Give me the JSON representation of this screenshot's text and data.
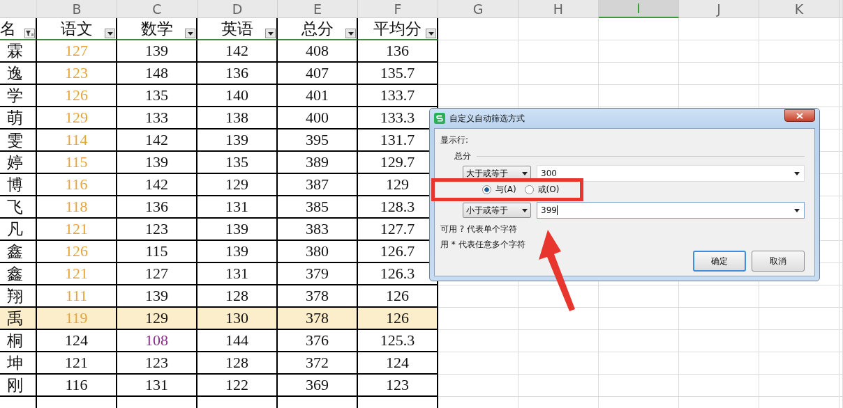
{
  "column_headers": [
    {
      "label": "B",
      "selected": false
    },
    {
      "label": "C",
      "selected": false
    },
    {
      "label": "D",
      "selected": false
    },
    {
      "label": "E",
      "selected": false
    },
    {
      "label": "F",
      "selected": false
    },
    {
      "label": "G",
      "selected": false
    },
    {
      "label": "H",
      "selected": false
    },
    {
      "label": "I",
      "selected": true
    },
    {
      "label": "J",
      "selected": false
    },
    {
      "label": "K",
      "selected": false
    }
  ],
  "table": {
    "headers": [
      {
        "label": "名",
        "filtered": true
      },
      {
        "label": "语文",
        "filtered": false
      },
      {
        "label": "数学",
        "filtered": false
      },
      {
        "label": "英语",
        "filtered": false
      },
      {
        "label": "总分",
        "filtered": false
      },
      {
        "label": "平均分",
        "filtered": false
      }
    ],
    "rows": [
      {
        "highlighted": false,
        "cells": [
          {
            "text": "霖"
          },
          {
            "text": "127",
            "color": "#e3a43a"
          },
          {
            "text": "139"
          },
          {
            "text": "142"
          },
          {
            "text": "408"
          },
          {
            "text": "136"
          }
        ]
      },
      {
        "highlighted": false,
        "cells": [
          {
            "text": "逸"
          },
          {
            "text": "123",
            "color": "#e3a43a"
          },
          {
            "text": "148"
          },
          {
            "text": "136"
          },
          {
            "text": "407"
          },
          {
            "text": "135.7"
          }
        ]
      },
      {
        "highlighted": false,
        "cells": [
          {
            "text": "学"
          },
          {
            "text": "126",
            "color": "#e3a43a"
          },
          {
            "text": "135"
          },
          {
            "text": "140"
          },
          {
            "text": "401"
          },
          {
            "text": "133.7"
          }
        ]
      },
      {
        "highlighted": false,
        "cells": [
          {
            "text": "萌"
          },
          {
            "text": "129",
            "color": "#e3a43a"
          },
          {
            "text": "133"
          },
          {
            "text": "138"
          },
          {
            "text": "400"
          },
          {
            "text": "133.3"
          }
        ]
      },
      {
        "highlighted": false,
        "cells": [
          {
            "text": "雯"
          },
          {
            "text": "114",
            "color": "#e3a43a"
          },
          {
            "text": "142"
          },
          {
            "text": "139"
          },
          {
            "text": "395"
          },
          {
            "text": "131.7"
          }
        ]
      },
      {
        "highlighted": false,
        "cells": [
          {
            "text": "婷"
          },
          {
            "text": "115",
            "color": "#e3a43a"
          },
          {
            "text": "139"
          },
          {
            "text": "135"
          },
          {
            "text": "389"
          },
          {
            "text": "129.7"
          }
        ]
      },
      {
        "highlighted": false,
        "cells": [
          {
            "text": "博"
          },
          {
            "text": "116",
            "color": "#e3a43a"
          },
          {
            "text": "142"
          },
          {
            "text": "129"
          },
          {
            "text": "387"
          },
          {
            "text": "129"
          }
        ]
      },
      {
        "highlighted": false,
        "cells": [
          {
            "text": "飞"
          },
          {
            "text": "118",
            "color": "#e3a43a"
          },
          {
            "text": "136"
          },
          {
            "text": "131"
          },
          {
            "text": "385"
          },
          {
            "text": "128.3"
          }
        ]
      },
      {
        "highlighted": false,
        "cells": [
          {
            "text": "凡"
          },
          {
            "text": "121",
            "color": "#e3a43a"
          },
          {
            "text": "123"
          },
          {
            "text": "139"
          },
          {
            "text": "383"
          },
          {
            "text": "127.7"
          }
        ]
      },
      {
        "highlighted": false,
        "cells": [
          {
            "text": "鑫"
          },
          {
            "text": "126",
            "color": "#e3a43a"
          },
          {
            "text": "115"
          },
          {
            "text": "139"
          },
          {
            "text": "380"
          },
          {
            "text": "126.7"
          }
        ]
      },
      {
        "highlighted": false,
        "cells": [
          {
            "text": "鑫"
          },
          {
            "text": "121",
            "color": "#e3a43a"
          },
          {
            "text": "127"
          },
          {
            "text": "131"
          },
          {
            "text": "379"
          },
          {
            "text": "126.3"
          }
        ]
      },
      {
        "highlighted": false,
        "cells": [
          {
            "text": "翔"
          },
          {
            "text": "111",
            "color": "#e3a43a"
          },
          {
            "text": "139"
          },
          {
            "text": "128"
          },
          {
            "text": "378"
          },
          {
            "text": "126"
          }
        ]
      },
      {
        "highlighted": true,
        "cells": [
          {
            "text": "禹"
          },
          {
            "text": "119",
            "color": "#e3a43a"
          },
          {
            "text": "129"
          },
          {
            "text": "130"
          },
          {
            "text": "378"
          },
          {
            "text": "126"
          }
        ]
      },
      {
        "highlighted": false,
        "cells": [
          {
            "text": "桐"
          },
          {
            "text": "124"
          },
          {
            "text": "108",
            "color": "#8b2a8b"
          },
          {
            "text": "144"
          },
          {
            "text": "376"
          },
          {
            "text": "125.3"
          }
        ]
      },
      {
        "highlighted": false,
        "cells": [
          {
            "text": "坤"
          },
          {
            "text": "121"
          },
          {
            "text": "123"
          },
          {
            "text": "128"
          },
          {
            "text": "372"
          },
          {
            "text": "124"
          }
        ]
      },
      {
        "highlighted": false,
        "cells": [
          {
            "text": "刚"
          },
          {
            "text": "116"
          },
          {
            "text": "131"
          },
          {
            "text": "122"
          },
          {
            "text": "369"
          },
          {
            "text": "123"
          }
        ]
      }
    ]
  },
  "dialog": {
    "title": "自定义自动筛选方式",
    "show_rows_label": "显示行:",
    "group_label": "总分",
    "conditions": [
      {
        "operator": "大于或等于",
        "value": "300",
        "focused": false
      },
      {
        "operator": "小于或等于",
        "value": "399",
        "focused": true
      }
    ],
    "logic": [
      {
        "label": "与(A)",
        "selected": true
      },
      {
        "label": "或(O)",
        "selected": false
      }
    ],
    "hints": [
      "可用 ? 代表单个字符",
      "用 * 代表任意多个字符"
    ],
    "buttons": [
      {
        "label": "确定",
        "default": true
      },
      {
        "label": "取消",
        "default": false
      }
    ]
  }
}
